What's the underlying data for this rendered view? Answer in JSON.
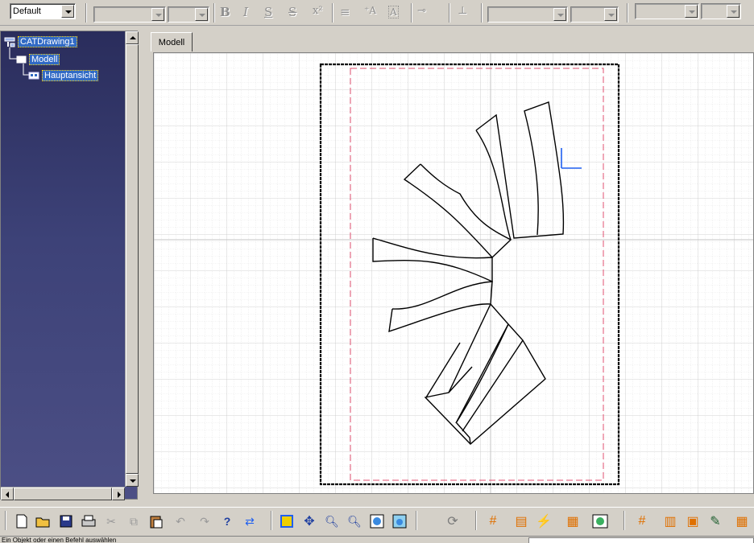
{
  "toolbar": {
    "style_combo_value": "Default"
  },
  "tree": {
    "root_label": "CATDrawing1",
    "sheet_label": "Modell",
    "view_label": "Hauptansicht"
  },
  "sheet": {
    "tab_label": "Modell"
  },
  "status": {
    "message": "Ein Objekt oder einen Befehl auswählen"
  },
  "colors": {
    "tree_background": "#3a3e6f",
    "selection": "#316ac5",
    "frame_dashed": "#e05070",
    "axis": "#1f5ff0"
  },
  "icons": {
    "bottom": [
      "new-file-icon",
      "open-file-icon",
      "save-icon",
      "print-icon",
      "cut-icon",
      "copy-icon",
      "paste-icon",
      "undo-icon",
      "redo-icon",
      "whats-this-icon",
      "swap-visible-icon",
      "fit-all-icon",
      "pan-icon",
      "zoom-in-icon",
      "zoom-out-icon",
      "normal-view-icon",
      "multi-view-icon",
      "update-icon",
      "grid-icon",
      "sheet-icon",
      "analysis-icon",
      "dimension-icon",
      "view-from-3d-icon",
      "grid-snap-icon",
      "frame-icon",
      "title-block-icon",
      "cursor-icon",
      "generate-icon"
    ]
  }
}
